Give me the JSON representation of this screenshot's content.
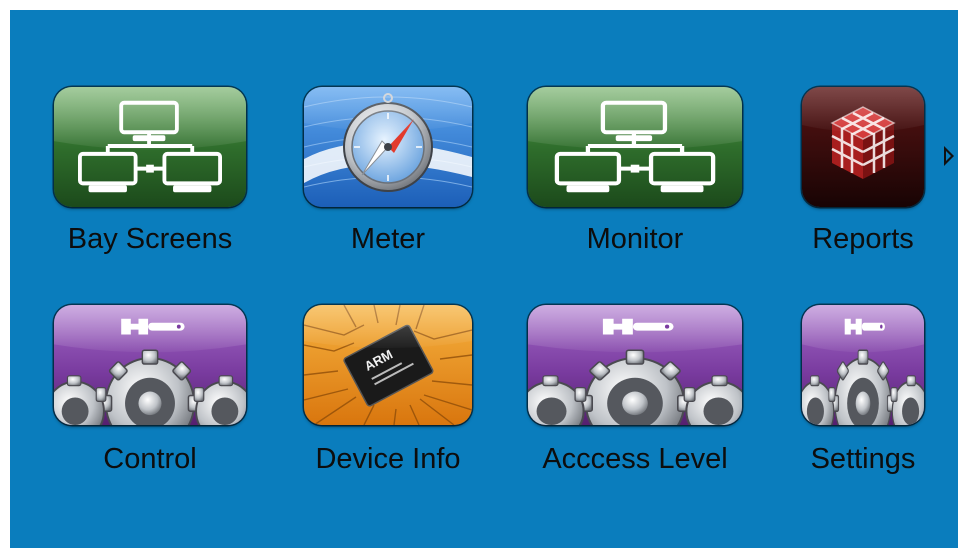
{
  "menu": {
    "row1": [
      {
        "label": "Bay Screens",
        "icon": "network-icon"
      },
      {
        "label": "Meter",
        "icon": "compass-icon"
      },
      {
        "label": "Monitor",
        "icon": "network-icon"
      },
      {
        "label": "Reports",
        "icon": "cube-icon"
      }
    ],
    "row2": [
      {
        "label": "Control",
        "icon": "gears-wrench-icon"
      },
      {
        "label": "Device Info",
        "icon": "chip-icon"
      },
      {
        "label": "Acccess Level",
        "icon": "gears-wrench-icon"
      },
      {
        "label": "Settings",
        "icon": "gears-wrench-icon"
      }
    ]
  },
  "pager": {
    "icon": "next-page-arrow-icon"
  },
  "colors": {
    "background": "#0a7dbd",
    "network_icon": "#2e6b2c",
    "compass_icon": "#3a7fd0",
    "reports_icon": "#3a0c0c",
    "gears_icon": "#7a3ca0",
    "chip_icon": "#e8901a"
  }
}
